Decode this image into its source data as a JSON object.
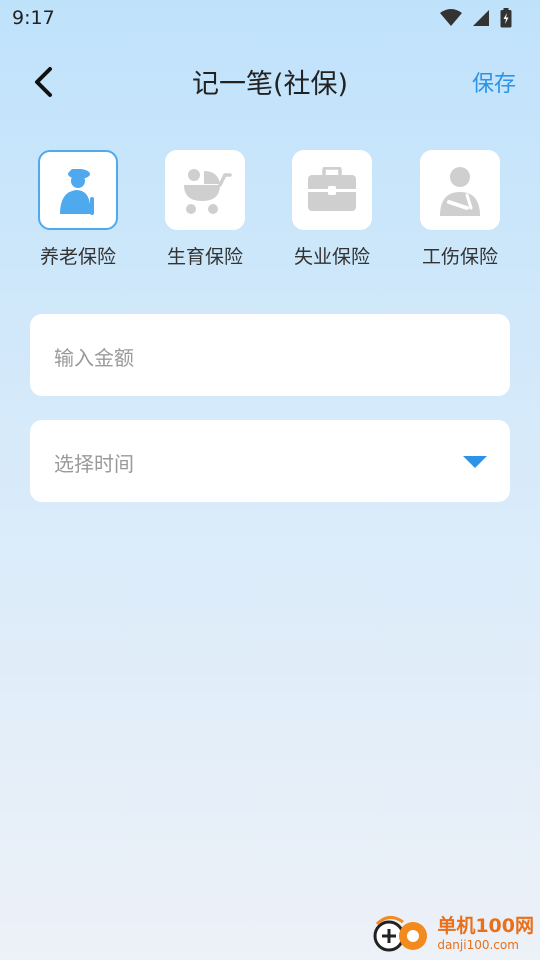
{
  "status_bar": {
    "time": "9:17"
  },
  "header": {
    "title": "记一笔(社保)",
    "save_label": "保存"
  },
  "categories": [
    {
      "label": "养老保险",
      "icon": "elderly-person-icon",
      "selected": true
    },
    {
      "label": "生育保险",
      "icon": "baby-stroller-icon",
      "selected": false
    },
    {
      "label": "失业保险",
      "icon": "briefcase-icon",
      "selected": false
    },
    {
      "label": "工伤保险",
      "icon": "injured-person-icon",
      "selected": false
    }
  ],
  "form": {
    "amount_placeholder": "输入金额",
    "time_placeholder": "选择时间"
  },
  "colors": {
    "accent": "#2b93e8",
    "selected_icon": "#4ea9ee",
    "inactive_icon": "#cfcfcf"
  },
  "watermark": {
    "name": "单机100网",
    "url": "danji100.com"
  }
}
